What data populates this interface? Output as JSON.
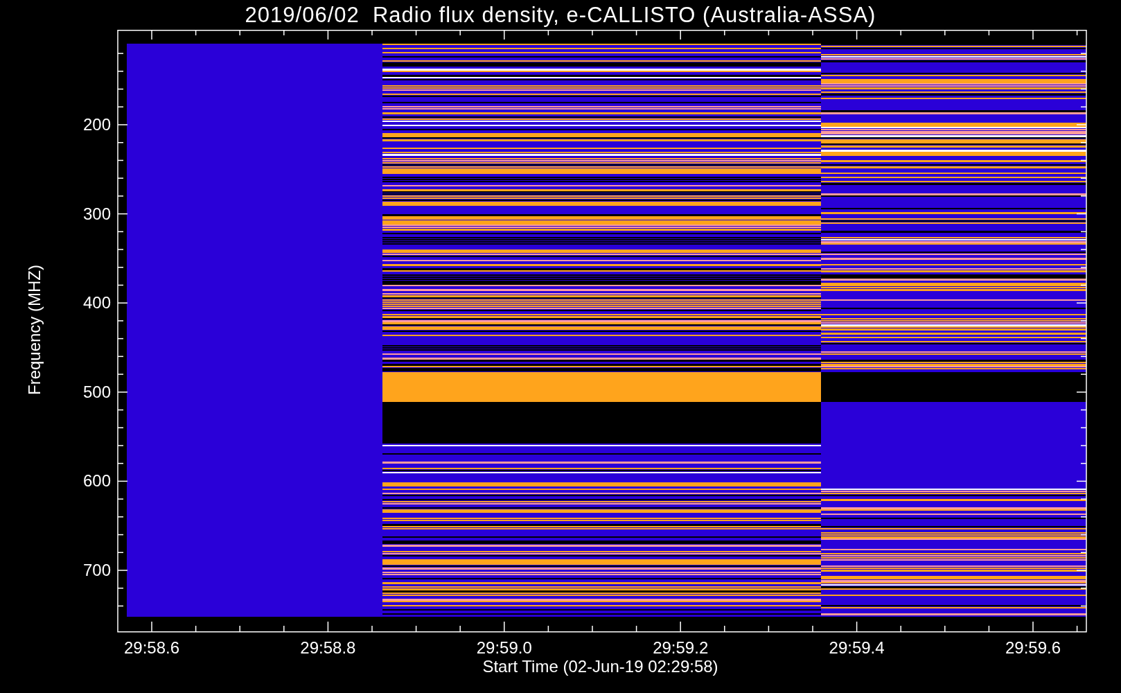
{
  "title": "2019/06/02  Radio flux density, e-CALLISTO (Australia-ASSA)",
  "y_axis": {
    "label": "Frequency (MHZ)",
    "ticks": [
      "200",
      "300",
      "400",
      "500",
      "600",
      "700"
    ]
  },
  "x_axis": {
    "label": "Start Time (02-Jun-19 02:29:58)",
    "ticks": [
      "29:58.6",
      "29:58.8",
      "29:59.0",
      "29:59.2",
      "29:59.4",
      "29:59.6"
    ]
  }
}
